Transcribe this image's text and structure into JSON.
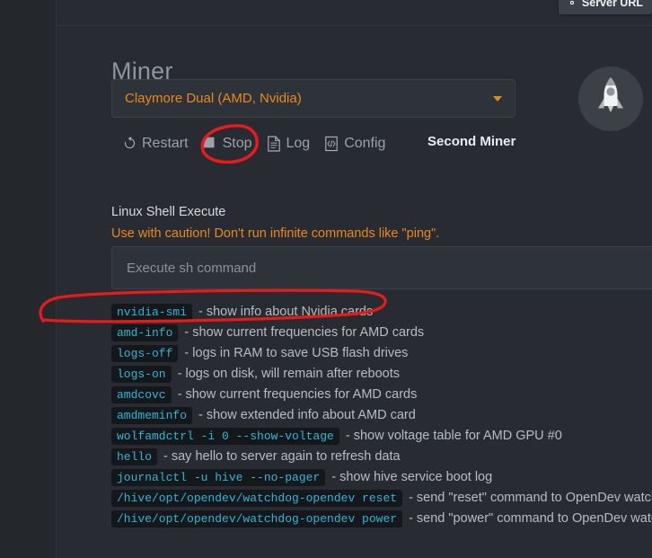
{
  "window": {
    "background_color": "#282c32",
    "accent_color": "#e8891c",
    "code_color": "#2fb6d8",
    "annotation_color": "#e81a1a"
  },
  "header": {
    "server_pill_label": "Server URL",
    "server_pill_icon": "gear-icon"
  },
  "main": {
    "page_title": "Miner",
    "avatar_icon": "rocket-icon"
  },
  "miner_select": {
    "value": "Claymore Dual (AMD, Nvidia)",
    "caret_icon": "chevron-down-icon"
  },
  "toolbar": {
    "buttons": [
      {
        "label": "Restart",
        "icon": "refresh-icon"
      },
      {
        "label": "Stop",
        "icon": "stop-square-icon"
      },
      {
        "label": "Log",
        "icon": "document-icon"
      },
      {
        "label": "Config",
        "icon": "code-file-icon"
      }
    ],
    "second_miner_label": "Second Miner"
  },
  "shell": {
    "section_label": "Linux Shell Execute",
    "warning": "Use with caution! Don't run infinite commands like \"ping\".",
    "input_value": "",
    "input_placeholder": "Execute sh command"
  },
  "commands": [
    {
      "cmd": "nvidia-smi",
      "desc": "- show info about Nvidia cards"
    },
    {
      "cmd": "amd-info",
      "desc": "- show current frequencies for AMD cards"
    },
    {
      "cmd": "logs-off",
      "desc": "- logs in RAM to save USB flash drives"
    },
    {
      "cmd": "logs-on",
      "desc": "- logs on disk, will remain after reboots"
    },
    {
      "cmd": "amdcovc",
      "desc": "- show current frequencies for AMD cards"
    },
    {
      "cmd": "amdmeminfo",
      "desc": "- show extended info about AMD card"
    },
    {
      "cmd": "wolfamdctrl -i 0 --show-voltage",
      "desc": "- show voltage table for AMD GPU #0"
    },
    {
      "cmd": "hello",
      "desc": "- say hello to server again to refresh data"
    },
    {
      "cmd": "journalctl -u hive --no-pager",
      "desc": "- show hive service boot log"
    },
    {
      "cmd": "/hive/opt/opendev/watchdog-opendev reset",
      "desc": "- send \"reset\" command to OpenDev watchdog"
    },
    {
      "cmd": "/hive/opt/opendev/watchdog-opendev power",
      "desc": "- send \"power\" command to OpenDev watchdog"
    }
  ],
  "annotations": [
    {
      "name": "log-button-circle",
      "target": "Log"
    },
    {
      "name": "commands-circle",
      "target": "nvidia-smi / amd-info"
    }
  ]
}
